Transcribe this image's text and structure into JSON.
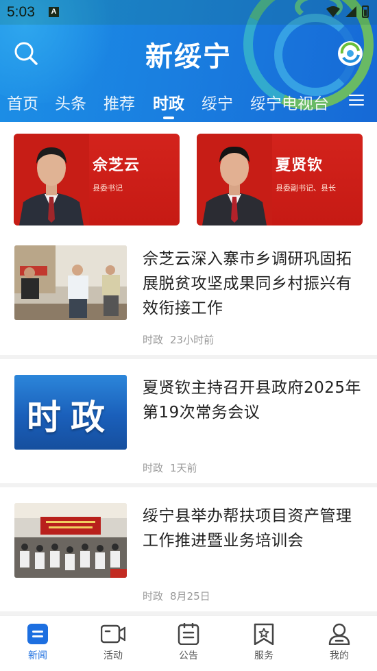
{
  "status_bar": {
    "time": "5:03",
    "notification_glyph": "A"
  },
  "header": {
    "app_title": "新绥宁",
    "search_icon": "search-icon",
    "logo_icon": "app-logo-icon"
  },
  "tabs": [
    {
      "label": "首页",
      "active": false
    },
    {
      "label": "头条",
      "active": false
    },
    {
      "label": "推荐",
      "active": false
    },
    {
      "label": "时政",
      "active": true
    },
    {
      "label": "绥宁",
      "active": false
    },
    {
      "label": "绥宁电视台",
      "active": false
    }
  ],
  "leaders": [
    {
      "name": "佘芝云",
      "title": "县委书记"
    },
    {
      "name": "夏贤钦",
      "title": "县委副书记、县长"
    }
  ],
  "news": [
    {
      "title": "佘芝云深入寨市乡调研巩固拓展脱贫攻坚成果同乡村振兴有效衔接工作",
      "category": "时政",
      "time": "23小时前",
      "thumb": "photo"
    },
    {
      "title": "夏贤钦主持召开县政府2025年第19次常务会议",
      "category": "时政",
      "time": "1天前",
      "thumb": "tile",
      "thumb_text": "时政"
    },
    {
      "title": "绥宁县举办帮扶项目资产管理工作推进暨业务培训会",
      "category": "时政",
      "time": "8月25日",
      "thumb": "photo"
    }
  ],
  "bottom_nav": [
    {
      "label": "新闻",
      "icon": "news-icon",
      "active": true
    },
    {
      "label": "活动",
      "icon": "video-icon",
      "active": false
    },
    {
      "label": "公告",
      "icon": "notice-icon",
      "active": false
    },
    {
      "label": "服务",
      "icon": "service-icon",
      "active": false
    },
    {
      "label": "我的",
      "icon": "profile-icon",
      "active": false
    }
  ],
  "colors": {
    "header_blue": "#1a7fe0",
    "active_blue": "#1d6fe0",
    "leader_red": "#c61a14",
    "meta_gray": "#999999"
  }
}
